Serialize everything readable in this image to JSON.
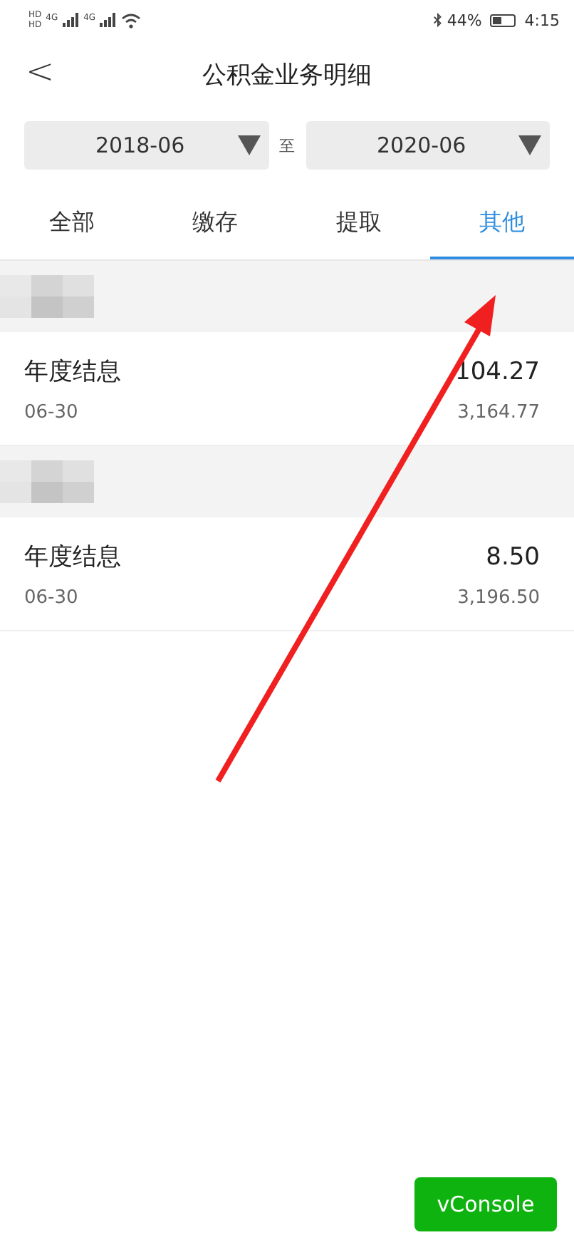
{
  "status_bar": {
    "hd_badges": [
      "HD",
      "HD"
    ],
    "network_labels": [
      "4G",
      "4G"
    ],
    "battery": "44%",
    "time": "4:15"
  },
  "header": {
    "back": "<",
    "title": "公积金业务明细"
  },
  "date_range": {
    "from": "2018-06",
    "separator": "至",
    "to": "2020-06"
  },
  "tabs": [
    {
      "label": "全部",
      "selected": false
    },
    {
      "label": "缴存",
      "selected": false
    },
    {
      "label": "提取",
      "selected": false
    },
    {
      "label": "其他",
      "selected": true
    }
  ],
  "groups": [
    {
      "items": [
        {
          "title": "年度结息",
          "date": "06-30",
          "amount": "104.27",
          "balance": "3,164.77"
        }
      ]
    },
    {
      "items": [
        {
          "title": "年度结息",
          "date": "06-30",
          "amount": "8.50",
          "balance": "3,196.50"
        }
      ]
    }
  ],
  "vconsole_button": "vConsole"
}
